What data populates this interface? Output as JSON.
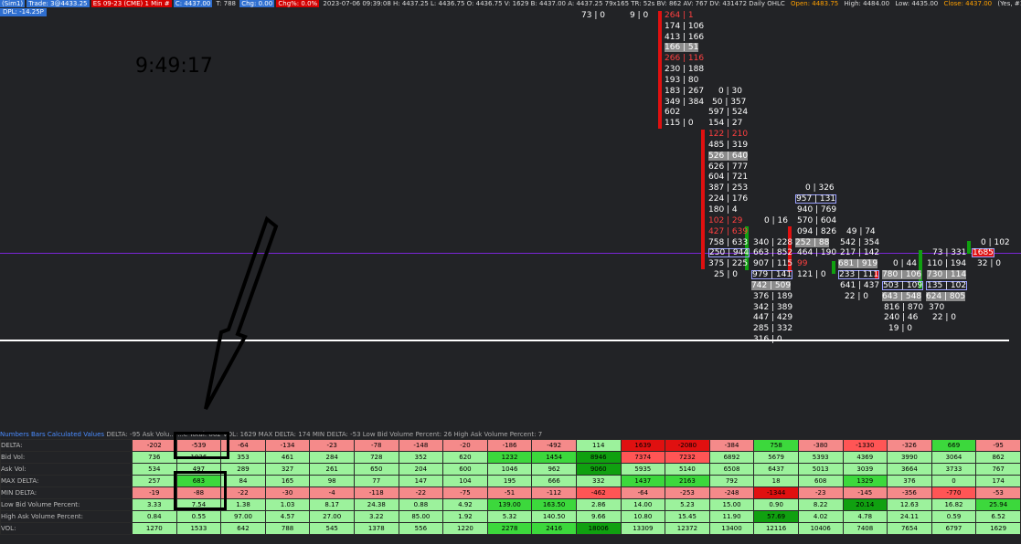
{
  "top_bar": {
    "account": "(Sim1)",
    "trade": "Trade: 3@4433.25",
    "instrument": "ES 09-23 (CME) 1 Min #",
    "last": "C: 4437.00",
    "t": "T: 788",
    "change": "Chg: 0.00",
    "change_pct": "Chg%: 0.0%",
    "stats": "2023-07-06 09:39:08 H: 4437.25 L: 4436.75 O: 4436.75 V: 1629 B: 4437.00 A: 4437.25 79x165 TR: 52s BV: 862 AV: 767 DV: 431472 Daily OHLC",
    "open": "Open: 4483.75",
    "high": "High: 4484.00",
    "low": "Low: 4435.00",
    "close": "Close: 4437.00",
    "params": "(Yes, #1, 0, No, No, 50, No,"
  },
  "dpl": "DPL: -14.25P",
  "clock": "9:49:17",
  "top_labels": [
    "73 | 0",
    "9 | 0"
  ],
  "footprint": [
    "264 | 1",
    "174 | 106",
    "413 | 166",
    "166 | 51",
    "266 | 116",
    "230 | 188",
    "193 | 80",
    "183 | 267",
    "349 | 384",
    "602",
    "115 | 0",
    "0 | 30",
    "50 | 357",
    "597 | 524",
    "154 | 27",
    "122 | 210",
    "485 | 319",
    "526 | 640",
    "626 | 777",
    "604 | 721",
    "387 | 253",
    "224 | 176",
    "180 | 4",
    "102 | 29",
    "427 | 639",
    "758 | 633",
    "250 | 944",
    "375 | 225",
    "25 | 0",
    "0 | 16",
    "340 | 228",
    "663 | 852",
    "907 | 115",
    "979 | 141",
    "742 | 509",
    "376 | 189",
    "342 | 389",
    "447 | 429",
    "285 | 332",
    "316 | 0",
    "0 | 326",
    "957 | 131",
    "940 | 769",
    "570 | 604",
    "094 | 826",
    "252 | 88",
    "464 | 190",
    "99",
    "121 | 0",
    "49 | 74",
    "542 | 354",
    "217 | 142",
    "681 | 919",
    "233 | 111",
    "641 | 437",
    "22 | 0",
    "0 | 44",
    "780 | 106",
    "503 | 109",
    "643 | 548",
    "816 | 870",
    "240 | 46",
    "19 | 0",
    "73 | 331",
    "110 | 194",
    "730 | 114",
    "135 | 102",
    "624 | 805",
    "370",
    "22 | 0",
    "0 | 102",
    "1685",
    "32 | 0"
  ],
  "table_header": {
    "title": "Numbers Bars Calculated Values",
    "summary": "DELTA: -95 Ask Volu... ...e Total: 862 VOL: 1629 MAX DELTA: 174 MIN DELTA: -53 Low Bid Volume Percent: 26 High Ask Volume Percent: 7"
  },
  "table": {
    "rows": [
      {
        "label": "DELTA:",
        "values": [
          "-202",
          "-539",
          "-64",
          "-134",
          "-23",
          "-78",
          "-148",
          "-20",
          "-186",
          "-492",
          "114",
          "1639",
          "-2080",
          "-384",
          "758",
          "-380",
          "-1330",
          "-326",
          "669",
          "-95"
        ]
      },
      {
        "label": "Bid Vol:",
        "values": [
          "736",
          "1036",
          "353",
          "461",
          "284",
          "728",
          "352",
          "620",
          "1232",
          "1454",
          "8946",
          "7374",
          "7232",
          "6892",
          "5679",
          "5393",
          "4369",
          "3990",
          "3064",
          "862"
        ]
      },
      {
        "label": "Ask Vol:",
        "values": [
          "534",
          "497",
          "289",
          "327",
          "261",
          "650",
          "204",
          "600",
          "1046",
          "962",
          "9060",
          "5935",
          "5140",
          "6508",
          "6437",
          "5013",
          "3039",
          "3664",
          "3733",
          "767"
        ]
      },
      {
        "label": "MAX DELTA:",
        "values": [
          "257",
          "683",
          "84",
          "165",
          "98",
          "77",
          "147",
          "104",
          "195",
          "666",
          "332",
          "1437",
          "2163",
          "792",
          "18",
          "608",
          "1329",
          "376",
          "0",
          "174"
        ]
      },
      {
        "label": "MIN DELTA:",
        "values": [
          "-19",
          "-88",
          "-22",
          "-30",
          "-4",
          "-118",
          "-22",
          "-75",
          "-51",
          "-112",
          "-462",
          "-64",
          "-253",
          "-248",
          "-1344",
          "-23",
          "-145",
          "-356",
          "-770",
          "-53"
        ]
      },
      {
        "label": "Low Bid Volume Percent:",
        "values": [
          "3.33",
          "7.54",
          "1.38",
          "1.03",
          "8.17",
          "24.38",
          "0.88",
          "4.92",
          "139.00",
          "163.50",
          "2.86",
          "14.00",
          "5.23",
          "15.00",
          "0.90",
          "8.22",
          "20.14",
          "12.63",
          "16.82",
          "25.94"
        ]
      },
      {
        "label": "High Ask Volume Percent:",
        "values": [
          "0.84",
          "0.55",
          "97.00",
          "4.57",
          "27.00",
          "3.22",
          "85.00",
          "1.92",
          "5.32",
          "140.50",
          "9.66",
          "10.80",
          "15.45",
          "11.90",
          "57.69",
          "4.02",
          "4.78",
          "24.11",
          "0.59",
          "6.52"
        ]
      },
      {
        "label": "VOL:",
        "values": [
          "1270",
          "1533",
          "642",
          "788",
          "545",
          "1378",
          "556",
          "1220",
          "2278",
          "2416",
          "18006",
          "13309",
          "12372",
          "13400",
          "12116",
          "10406",
          "7408",
          "7654",
          "6797",
          "1629"
        ]
      }
    ]
  },
  "colors": {
    "background": "#222326",
    "purple_line": "#7a25d6",
    "red": "#e01010",
    "green": "#10a010"
  }
}
